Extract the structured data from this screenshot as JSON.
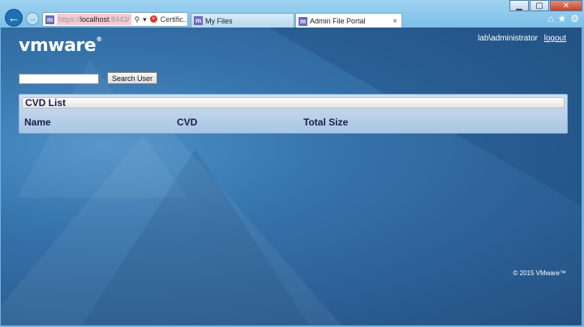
{
  "window": {
    "minimize": "▁",
    "maximize": "▢",
    "close": "✕"
  },
  "address_bar": {
    "protocol": "https://",
    "host": "localhost",
    "rest": ":8443/",
    "search_icon": "search-icon",
    "cert_error_label": "Certific..."
  },
  "tabs": [
    {
      "label": "My Files"
    },
    {
      "label": "Admin File Portal",
      "close": "×"
    }
  ],
  "chrome_icons": [
    "home-icon",
    "star-icon",
    "gear-icon"
  ],
  "header": {
    "logo": "vmware",
    "logo_mark": "®",
    "user": "lab\\administrator",
    "logout": "logout"
  },
  "search": {
    "value": "",
    "button": "Search User"
  },
  "cvd_panel": {
    "title": "CVD List",
    "columns": [
      "Name",
      "CVD",
      "Total Size"
    ]
  },
  "footer": {
    "copyright": "© 2015 VMware™"
  },
  "colors": {
    "page_bg": "#2b5f95",
    "chrome": "#7cc0e8",
    "panel": "#a9c6e3"
  }
}
